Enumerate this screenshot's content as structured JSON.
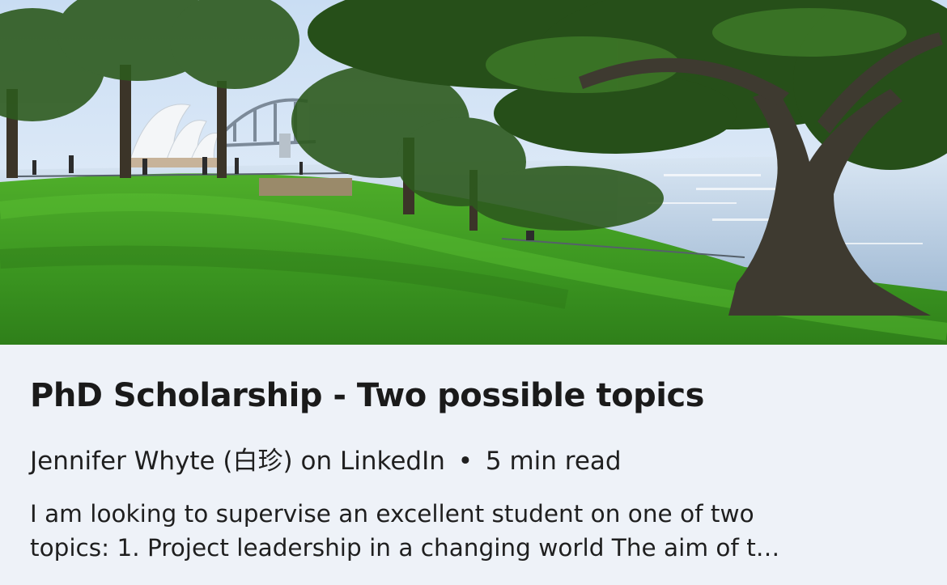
{
  "article": {
    "title": "PhD Scholarship - Two possible topics",
    "author": "Jennifer Whyte (白珍)",
    "source": "on LinkedIn",
    "separator": "•",
    "read_time": "5 min read",
    "excerpt_line1": "I am looking to supervise an excellent student on one of two",
    "excerpt_line2": "topics: 1. Project leadership in a changing world The aim of t…"
  },
  "image": {
    "subject": "Sydney harbour parkland with fig tree, Opera House and Harbour Bridge",
    "colors": {
      "sky": "#dce9f7",
      "grass": "#3f9a22",
      "water": "#b9cde4",
      "card_bg": "#eef2f8",
      "text": "#1a1a1a"
    }
  }
}
